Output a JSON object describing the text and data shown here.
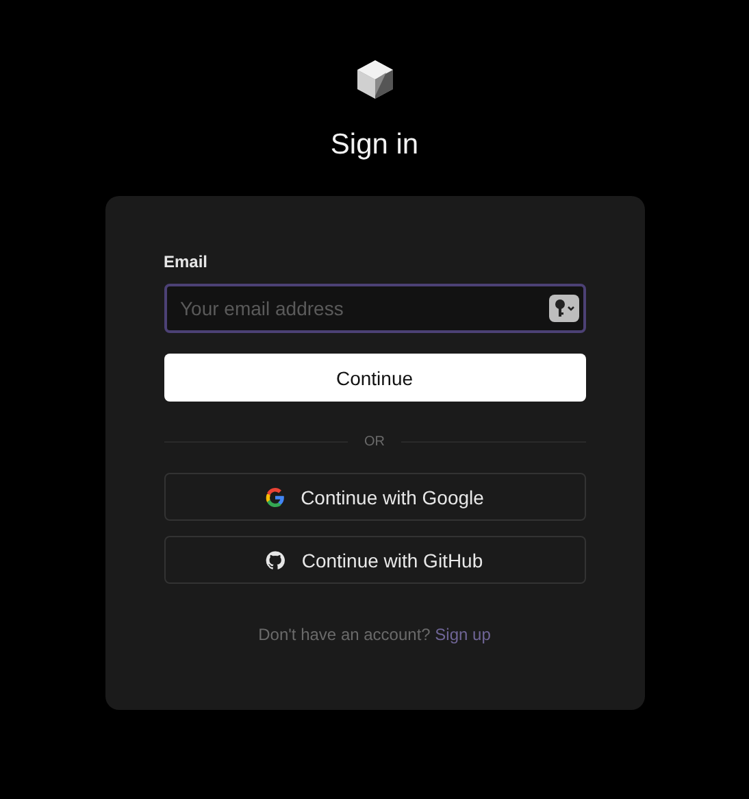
{
  "title": "Sign in",
  "email": {
    "label": "Email",
    "placeholder": "Your email address"
  },
  "continue_button": "Continue",
  "divider": "OR",
  "providers": [
    {
      "kind": "google",
      "label": "Continue with Google"
    },
    {
      "kind": "github",
      "label": "Continue with GitHub"
    }
  ],
  "footer": {
    "text": "Don't have an account?",
    "link": "Sign up"
  }
}
